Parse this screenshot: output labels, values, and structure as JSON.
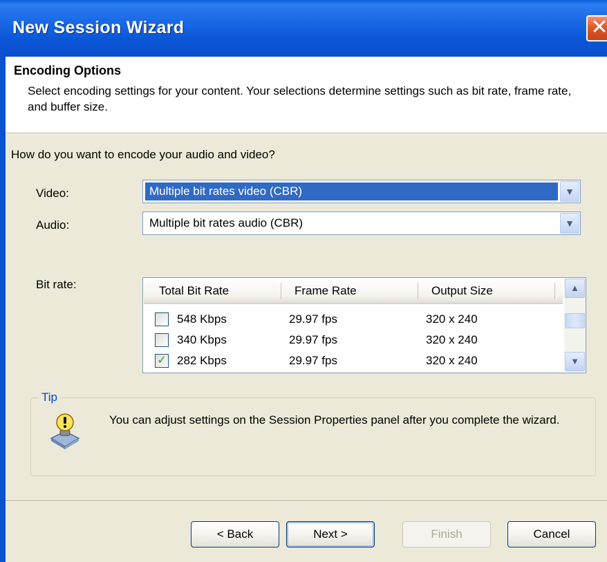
{
  "window": {
    "title": "New Session Wizard",
    "close_label": "✕"
  },
  "header": {
    "title": "Encoding Options",
    "description": "Select encoding settings for your content. Your selections determine settings such as bit rate, frame rate, and buffer size."
  },
  "question": "How do you want to encode your audio and video?",
  "video": {
    "label": "Video:",
    "value": "Multiple bit rates video (CBR)"
  },
  "audio": {
    "label": "Audio:",
    "value": "Multiple bit rates audio (CBR)"
  },
  "bitrate": {
    "label": "Bit rate:",
    "columns": [
      "Total Bit Rate",
      "Frame Rate",
      "Output Size"
    ],
    "rows": [
      {
        "checked": false,
        "bitrate": "548 Kbps",
        "frame_rate": "29.97 fps",
        "size": "320 x 240"
      },
      {
        "checked": false,
        "bitrate": "340 Kbps",
        "frame_rate": "29.97 fps",
        "size": "320 x 240"
      },
      {
        "checked": true,
        "bitrate": "282 Kbps",
        "frame_rate": "29.97 fps",
        "size": "320 x 240"
      }
    ]
  },
  "tip": {
    "label": "Tip",
    "text": "You can adjust settings on the Session Properties panel after you complete the wizard."
  },
  "buttons": {
    "back": "< Back",
    "next": "Next >",
    "finish": "Finish",
    "cancel": "Cancel"
  },
  "colors": {
    "titlebar": "#0b56d6",
    "selection": "#316ac5",
    "tip_label": "#0046d5",
    "check": "#21a121"
  },
  "icons": {
    "close": "close-icon",
    "dropdown": "chevron-down-icon",
    "scroll_up": "scroll-up-icon",
    "scroll_down": "scroll-down-icon",
    "tip": "lightbulb-tip-icon"
  }
}
